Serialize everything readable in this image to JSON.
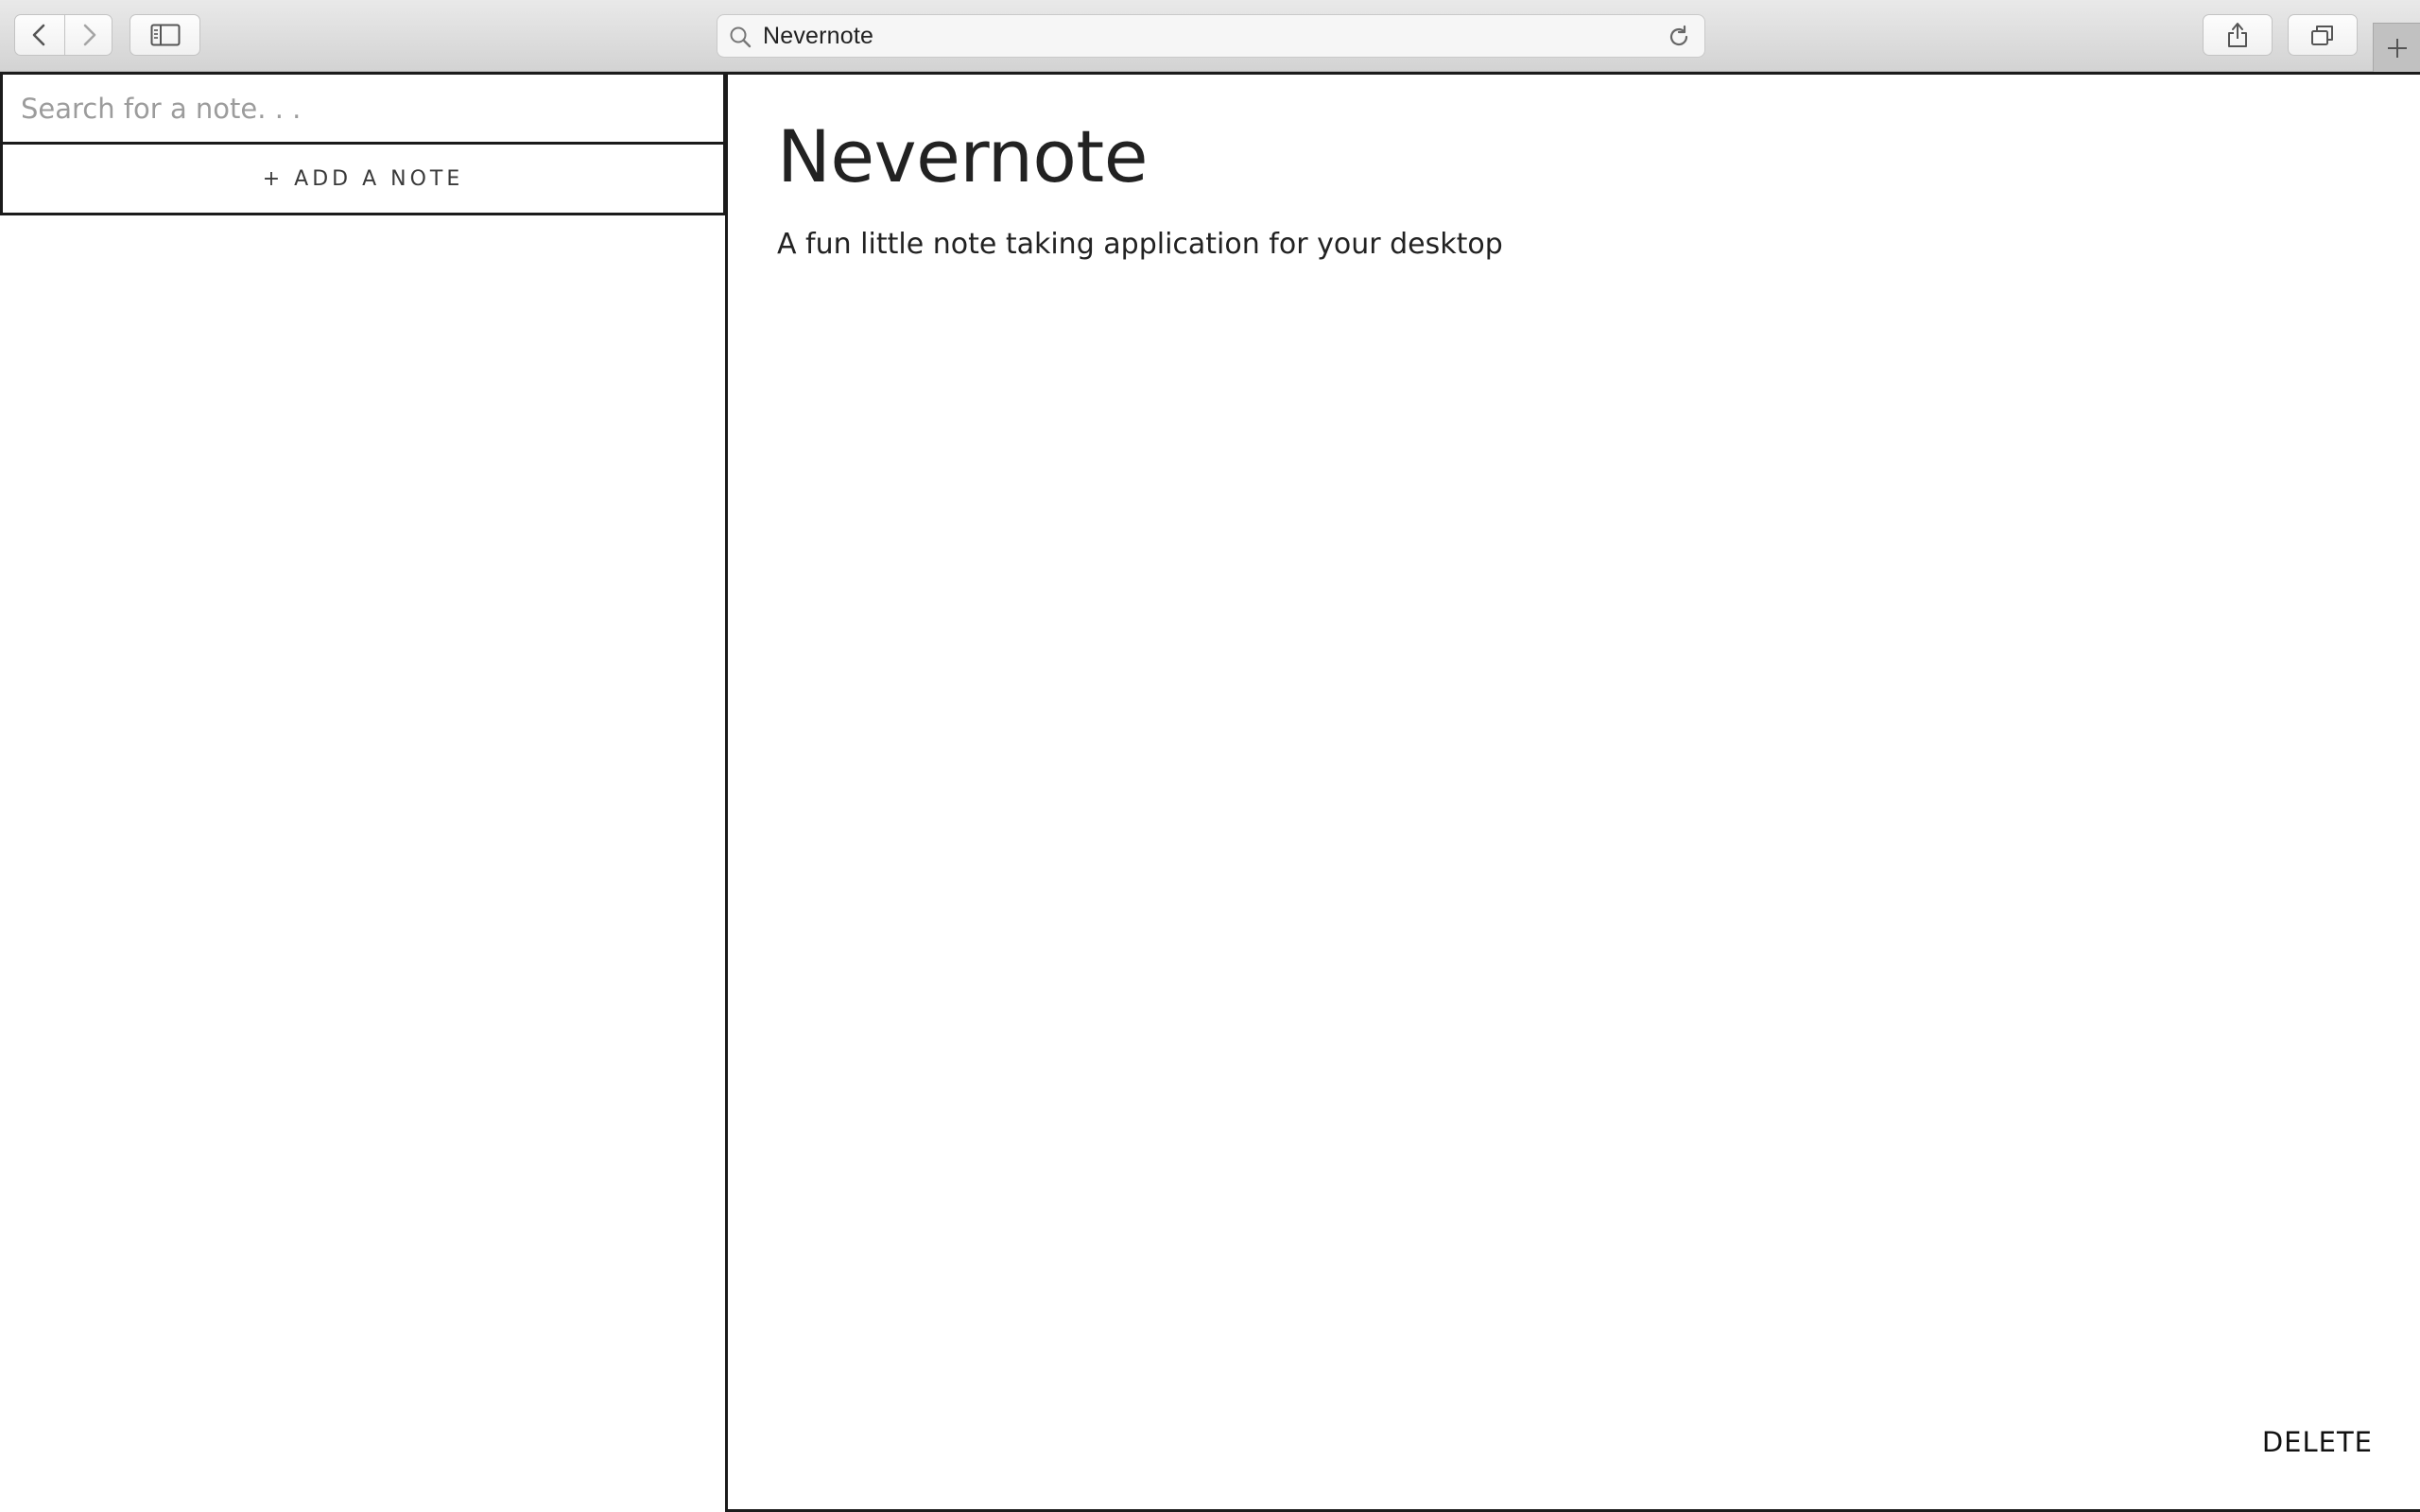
{
  "browser": {
    "address": "Nevernote",
    "icons": {
      "back": "chevron-left-icon",
      "forward": "chevron-right-icon",
      "sidebar": "sidebar-icon",
      "search": "magnifier-icon",
      "reload": "reload-icon",
      "share": "share-icon",
      "tabs": "tabs-icon",
      "new_tab": "plus-icon"
    }
  },
  "sidebar": {
    "search_placeholder": "Search for a note. . .",
    "add_note_label": "+ ADD A NOTE"
  },
  "note": {
    "title": "Nevernote",
    "body": "A fun little note taking application for your desktop",
    "delete_label": "DELETE"
  },
  "colors": {
    "border": "#1b1b1b",
    "text": "#222222",
    "placeholder": "#9c9c9c",
    "toolbar": "#dcdcdc"
  }
}
